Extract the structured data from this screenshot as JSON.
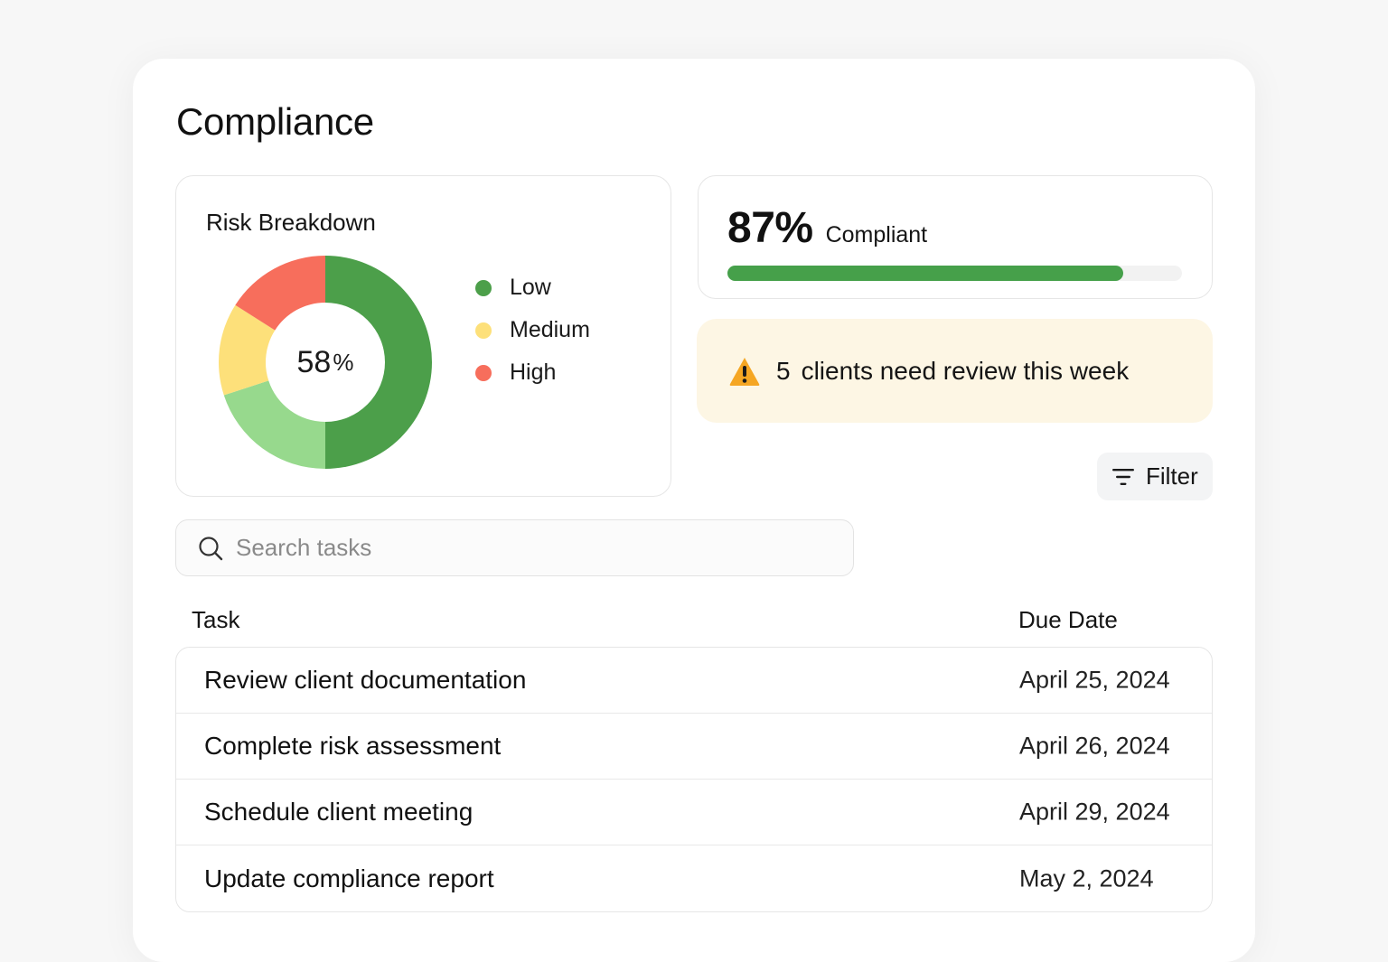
{
  "page": {
    "title": "Compliance"
  },
  "risk": {
    "title": "Risk Breakdown",
    "center_value": "58",
    "center_unit": "%",
    "legend": [
      {
        "label": "Low",
        "color": "#4c9f4a"
      },
      {
        "label": "Medium",
        "color": "#fde07a"
      },
      {
        "label": "High",
        "color": "#f76e5c"
      }
    ]
  },
  "chart_data": {
    "type": "pie",
    "title": "Risk Breakdown",
    "categories": [
      "Low",
      "Medium",
      "High"
    ],
    "values": [
      58,
      14,
      13
    ],
    "center_label": "58%",
    "legend_position": "right",
    "slices": [
      {
        "label": "Low",
        "value": 50,
        "color": "#4c9f4a"
      },
      {
        "label": "Low (light)",
        "value": 20,
        "color": "#97d98d"
      },
      {
        "label": "Medium",
        "value": 14,
        "color": "#fde07a"
      },
      {
        "label": "High",
        "value": 16,
        "color": "#f76e5c"
      }
    ]
  },
  "compliance": {
    "value": "87%",
    "label": "Compliant",
    "progress_fraction": 0.87,
    "bar_color": "#46a04a"
  },
  "alert": {
    "count": "5",
    "text": "clients need review this week",
    "icon": "warning-icon",
    "bg_color": "#fdf6e4"
  },
  "filter": {
    "label": "Filter",
    "icon": "filter-icon"
  },
  "search": {
    "placeholder": "Search tasks",
    "value": "",
    "icon": "search-icon"
  },
  "table": {
    "headers": {
      "task": "Task",
      "due": "Due Date"
    },
    "rows": [
      {
        "task": "Review client documentation",
        "due": "April 25, 2024"
      },
      {
        "task": "Complete risk assessment",
        "due": "April 26, 2024"
      },
      {
        "task": "Schedule client meeting",
        "due": "April 29, 2024"
      },
      {
        "task": "Update compliance report",
        "due": "May 2, 2024"
      }
    ]
  }
}
